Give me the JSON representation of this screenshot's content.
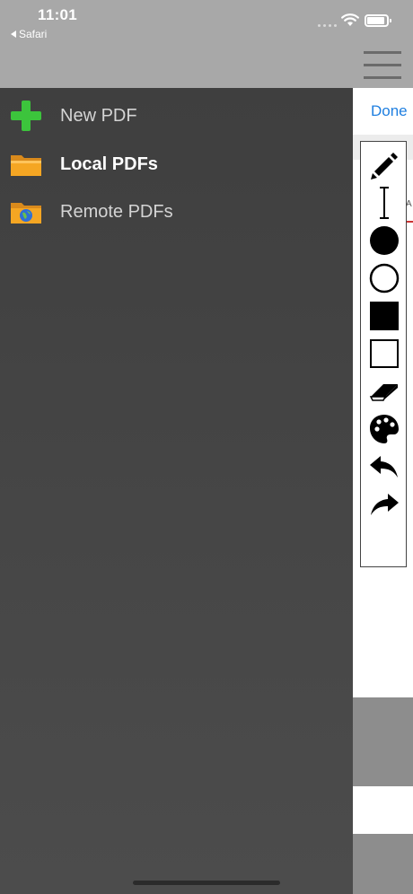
{
  "status_bar": {
    "time": "11:01",
    "back_app": "Safari"
  },
  "drawer": {
    "items": [
      {
        "label": "New PDF",
        "icon": "plus-icon",
        "active": false
      },
      {
        "label": "Local PDFs",
        "icon": "folder-icon",
        "active": true
      },
      {
        "label": "Remote PDFs",
        "icon": "globe-folder-icon",
        "active": false
      }
    ]
  },
  "document": {
    "done_label": "Done",
    "page_mark": "A"
  },
  "toolbar": {
    "tools": [
      {
        "name": "pencil-icon"
      },
      {
        "name": "text-cursor-icon"
      },
      {
        "name": "filled-circle-icon"
      },
      {
        "name": "outline-circle-icon"
      },
      {
        "name": "filled-square-icon"
      },
      {
        "name": "outline-square-icon"
      },
      {
        "name": "eraser-icon"
      },
      {
        "name": "palette-icon"
      },
      {
        "name": "undo-icon"
      },
      {
        "name": "redo-icon"
      }
    ]
  },
  "colors": {
    "drawer_bg": "#444444",
    "accent_blue": "#1f7fe0",
    "plus_green": "#3cc43c",
    "folder_orange": "#f5a623"
  }
}
